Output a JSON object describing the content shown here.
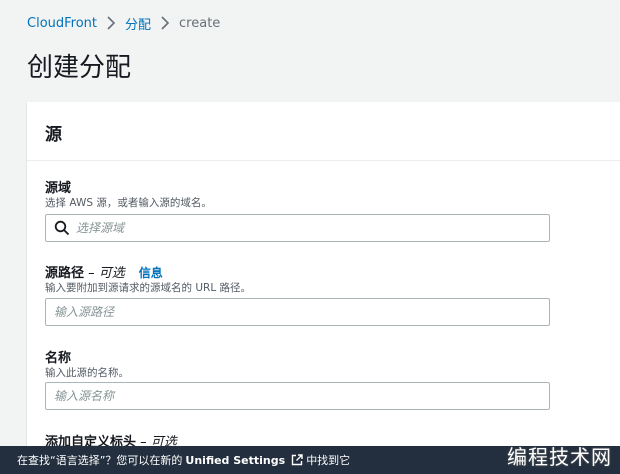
{
  "breadcrumb": {
    "root": "CloudFront",
    "parent": "分配",
    "current": "create"
  },
  "page": {
    "title": "创建分配"
  },
  "section": {
    "title": "源"
  },
  "fields": {
    "origin_domain": {
      "label": "源域",
      "description": "选择 AWS 源，或者输入源的域名。",
      "placeholder": "选择源域"
    },
    "origin_path": {
      "label": "源路径",
      "optional": " – 可选",
      "info": "信息",
      "description": "输入要附加到源请求的源域名的 URL 路径。",
      "placeholder": "输入源路径"
    },
    "name": {
      "label": "名称",
      "description": "输入此源的名称。",
      "placeholder": "输入源名称"
    },
    "custom_header": {
      "label": "添加自定义标头",
      "optional": " – 可选"
    }
  },
  "footer": {
    "prefix": "在查找“语言选择”？您可以在新的",
    "link": "Unified Settings",
    "suffix": "中找到它"
  },
  "watermark": "编程技术网",
  "colors": {
    "link": "#0073bb",
    "footer_bg": "#232f3e",
    "page_bg": "#f2f3f3"
  },
  "icons": {
    "breadcrumb_separator": "chevron-right-icon",
    "search": "search-icon",
    "external": "external-link-icon"
  }
}
